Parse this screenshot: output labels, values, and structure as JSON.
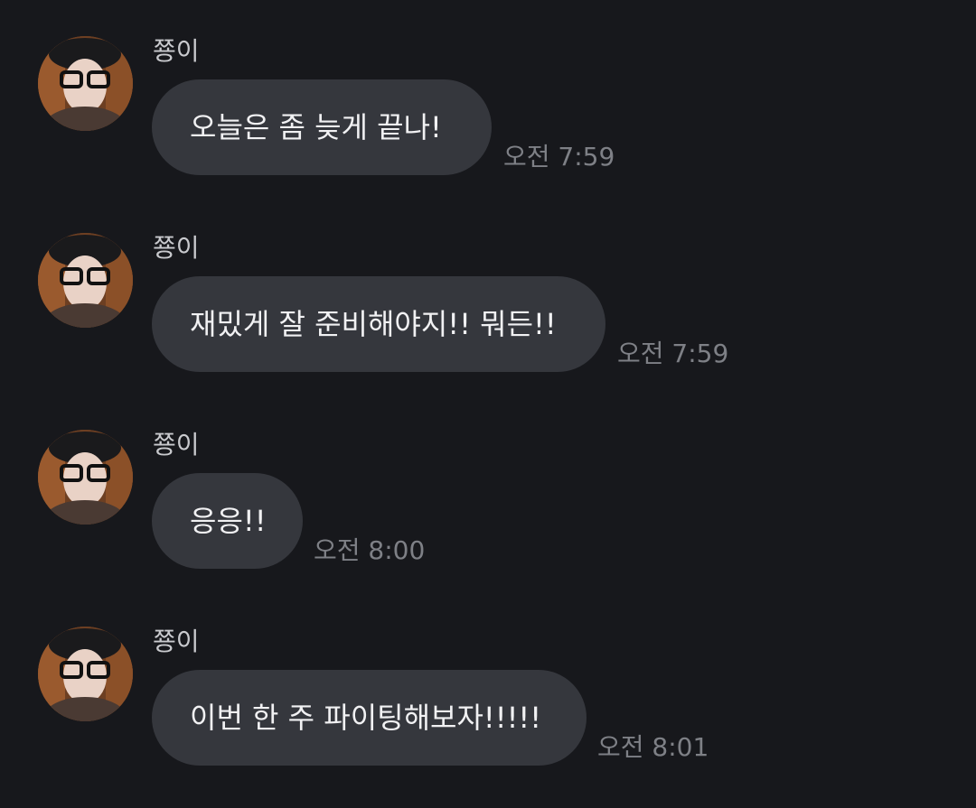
{
  "messages": [
    {
      "sender": "쭁이",
      "text": "오늘은 좀 늦게 끝나!",
      "time": "오전 7:59"
    },
    {
      "sender": "쭁이",
      "text": "재밌게 잘 준비해야지!! 뭐든!!",
      "time": "오전 7:59"
    },
    {
      "sender": "쭁이",
      "text": "응응!!",
      "time": "오전 8:00"
    },
    {
      "sender": "쭁이",
      "text": "이번 한 주 파이팅해보자!!!!!",
      "time": "오전 8:01"
    }
  ],
  "colors": {
    "background": "#17181c",
    "bubble": "#35373d",
    "text": "#f1f1f3",
    "sender": "#c9cace",
    "time": "#7e8086"
  },
  "icons": {
    "avatar": "profile-photo"
  }
}
